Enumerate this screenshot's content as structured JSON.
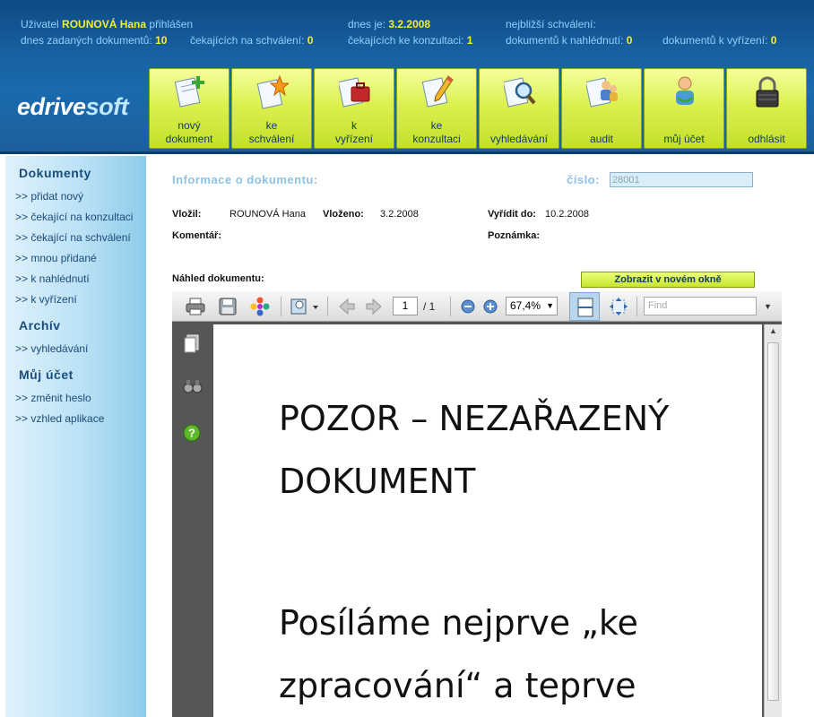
{
  "header": {
    "user_prefix": "Uživatel",
    "user_name": "ROUNOVÁ Hana",
    "user_suffix": "přihlášen",
    "today_label": "dnes je:",
    "today_value": "3.2.2008",
    "next_approval_label": "nejbližší schválení:",
    "docs_today_label": "dnes zadaných dokumentů:",
    "docs_today_value": "10",
    "awaiting_approval_label": "čekajících na schválení:",
    "awaiting_approval_value": "0",
    "awaiting_consult_label": "čekajících ke konzultaci:",
    "awaiting_consult_value": "1",
    "docs_to_view_label": "dokumentů k nahlédnutí:",
    "docs_to_view_value": "0",
    "docs_to_resolve_label": "dokumentů k vyřízení:",
    "docs_to_resolve_value": "0",
    "logo_a": "edrive",
    "logo_b": "soft"
  },
  "nav": [
    {
      "line1": "nový",
      "line2": "dokument",
      "icon": "new-document-icon"
    },
    {
      "line1": "ke",
      "line2": "schválení",
      "icon": "approval-star-icon"
    },
    {
      "line1": "k",
      "line2": "vyřízení",
      "icon": "briefcase-icon"
    },
    {
      "line1": "ke",
      "line2": "konzultaci",
      "icon": "pencil-consult-icon"
    },
    {
      "line1": "",
      "line2": "vyhledávání",
      "icon": "magnifier-icon"
    },
    {
      "line1": "",
      "line2": "audit",
      "icon": "audit-people-icon"
    },
    {
      "line1": "",
      "line2": "můj účet",
      "icon": "user-account-icon"
    },
    {
      "line1": "",
      "line2": "odhlásit",
      "icon": "padlock-icon"
    }
  ],
  "sidebar": {
    "section1": "Dokumenty",
    "links1": [
      ">> přidat nový",
      ">> čekající na konzultaci",
      ">> čekající na schválení",
      ">> mnou přidané",
      ">> k nahlédnutí",
      ">> k vyřízení"
    ],
    "section2": "Archív",
    "links2": [
      ">> vyhledávání"
    ],
    "section3": "Můj účet",
    "links3": [
      ">> změnit heslo",
      ">> vzhled aplikace"
    ]
  },
  "info": {
    "title": "Informace o dokumentu:",
    "number_label": "číslo:",
    "number_value": "28001",
    "inserted_by_label": "Vložil:",
    "inserted_by_value": "ROUNOVÁ Hana",
    "inserted_label": "Vloženo:",
    "inserted_value": "3.2.2008",
    "due_label": "Vyřídit do:",
    "due_value": "10.2.2008",
    "comment_label": "Komentář:",
    "note_label": "Poznámka:",
    "preview_label": "Náhled dokumentu:",
    "open_window_button": "Zobrazit v novém okně"
  },
  "viewer": {
    "page_current": "1",
    "page_total": "/ 1",
    "zoom": "67,4%",
    "find_placeholder": "Find",
    "doc_lines": [
      "POZOR – NEZAŘAZENÝ",
      "DOKUMENT",
      "Posíláme nejprve „ke",
      "zpracování“ a teprve"
    ]
  },
  "colors": {
    "header_bg": "#17609f",
    "accent_yellow": "#f4f02a",
    "nav_button": "#dcf050",
    "label_blue": "#8ec2e4"
  }
}
